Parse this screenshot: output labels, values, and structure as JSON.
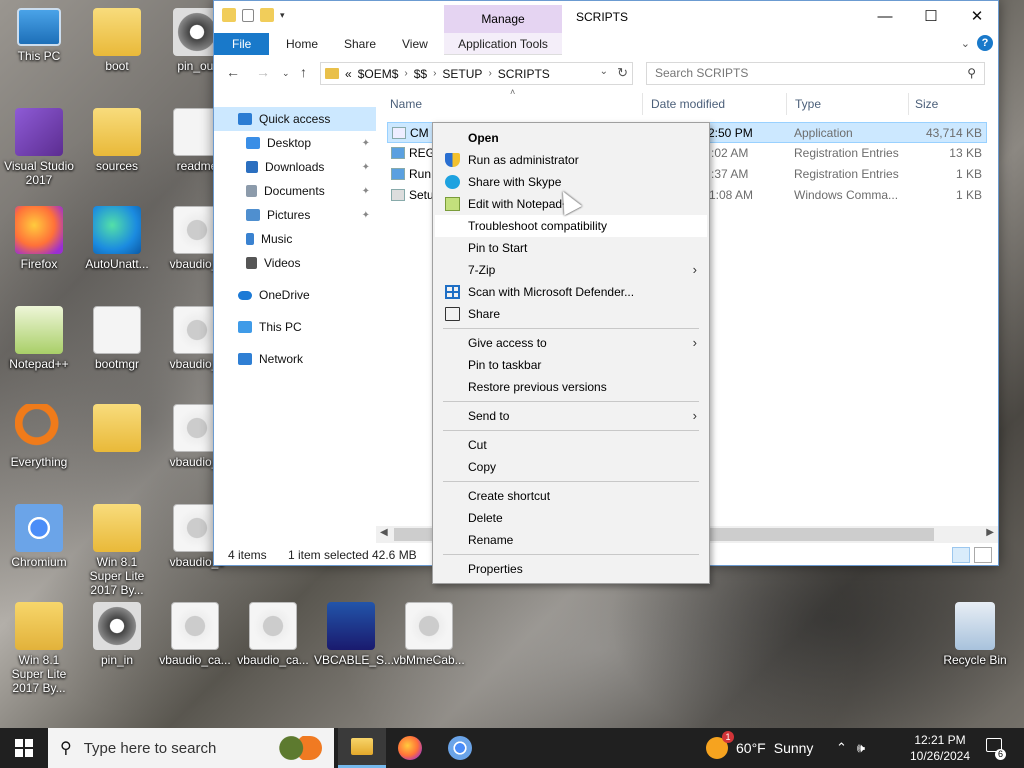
{
  "desktop": {
    "icons": [
      {
        "label": "This PC"
      },
      {
        "label": "boot"
      },
      {
        "label": "pin_out"
      },
      {
        "label": "Visual Studio 2017"
      },
      {
        "label": "sources"
      },
      {
        "label": "readme"
      },
      {
        "label": "Firefox"
      },
      {
        "label": "AutoUnatt..."
      },
      {
        "label": "vbaudio_c"
      },
      {
        "label": "Notepad++"
      },
      {
        "label": "bootmgr"
      },
      {
        "label": "vbaudio_c"
      },
      {
        "label": "Everything"
      },
      {
        "label": "vbaudio_c"
      },
      {
        "label": "Chromium"
      },
      {
        "label": "Win 8.1 Super Lite 2017 By..."
      },
      {
        "label": "vbaudio_c"
      },
      {
        "label": "Win 8.1 Super Lite 2017 By..."
      },
      {
        "label": "pin_in"
      },
      {
        "label": "vbaudio_ca..."
      },
      {
        "label": "vbaudio_ca..."
      },
      {
        "label": "VBCABLE_S..."
      },
      {
        "label": "vbMmeCab..."
      },
      {
        "label": "Recycle Bin"
      }
    ]
  },
  "explorer": {
    "title": "SCRIPTS",
    "manage_label": "Manage",
    "tabs": {
      "file": "File",
      "home": "Home",
      "share": "Share",
      "view": "View",
      "app_tools": "Application Tools"
    },
    "address": {
      "prefix": "«",
      "segments": [
        "$OEM$",
        "$$",
        "SETUP",
        "SCRIPTS"
      ]
    },
    "search_placeholder": "Search SCRIPTS",
    "nav": {
      "quick_access": "Quick access",
      "desktop": "Desktop",
      "downloads": "Downloads",
      "documents": "Documents",
      "pictures": "Pictures",
      "music": "Music",
      "videos": "Videos",
      "onedrive": "OneDrive",
      "this_pc": "This PC",
      "network": "Network"
    },
    "columns": {
      "name": "Name",
      "date": "Date modified",
      "type": "Type",
      "size": "Size"
    },
    "files": [
      {
        "name": "CM",
        "date": "2:50 PM",
        "type": "Application",
        "size": "43,714 KB"
      },
      {
        "name": "REG",
        "date": ":02 AM",
        "type": "Registration Entries",
        "size": "13 KB"
      },
      {
        "name": "Run",
        "date": ":37 AM",
        "type": "Registration Entries",
        "size": "1 KB"
      },
      {
        "name": "Setu",
        "date": "1:08 AM",
        "type": "Windows Comma...",
        "size": "1 KB"
      }
    ],
    "status": {
      "items": "4 items",
      "selected": "1 item selected",
      "size": "42.6 MB"
    }
  },
  "context_menu": {
    "open": "Open",
    "run_admin": "Run as administrator",
    "share_skype": "Share with Skype",
    "edit_notepad": "Edit with Notepad++",
    "troubleshoot": "Troubleshoot compatibility",
    "pin_start": "Pin to Start",
    "zip": "7-Zip",
    "defender": "Scan with Microsoft Defender...",
    "share": "Share",
    "give_access": "Give access to",
    "pin_taskbar": "Pin to taskbar",
    "restore": "Restore previous versions",
    "send_to": "Send to",
    "cut": "Cut",
    "copy": "Copy",
    "create_shortcut": "Create shortcut",
    "delete": "Delete",
    "rename": "Rename",
    "properties": "Properties"
  },
  "taskbar": {
    "search_placeholder": "Type here to search",
    "weather_temp": "60°F",
    "weather_desc": "Sunny",
    "weather_badge": "1",
    "time": "12:21 PM",
    "date": "10/26/2024",
    "notifications": "6"
  }
}
